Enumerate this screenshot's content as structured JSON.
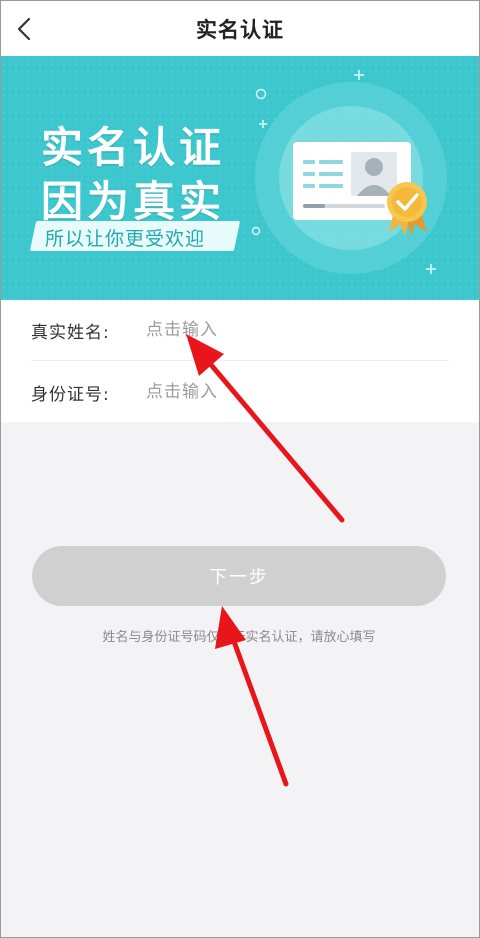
{
  "header": {
    "title": "实名认证"
  },
  "banner": {
    "line1": "实名认证",
    "line2": "因为真实",
    "tagline": "所以让你更受欢迎"
  },
  "form": {
    "name_label": "真实姓名:",
    "name_placeholder": "点击输入",
    "id_label": "身份证号:",
    "id_placeholder": "点击输入"
  },
  "actions": {
    "next_label": "下一步"
  },
  "notice": "姓名与身份证号码仅用于实名认证，请放心填写",
  "colors": {
    "banner_bg": "#3cc7cf",
    "button_disabled": "#d0d0d0",
    "annotation_arrow": "#e8161b"
  }
}
